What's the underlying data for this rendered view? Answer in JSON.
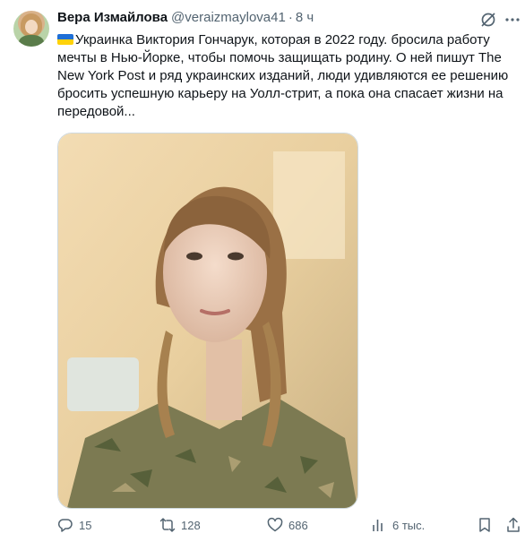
{
  "author": {
    "display_name": "Вера Измайлова",
    "handle": "@veraizmaylova41",
    "separator": "·",
    "time": "8 ч"
  },
  "tweet": {
    "flag_icon": "ukraine-flag-icon",
    "text": "Украинка Виктория Гончарук, которая в 2022 году. бросила работу мечты в Нью-Йорке, чтобы помочь защищать родину. О ней пишут The New York Post и ряд украинских изданий, люди удивляются ее решению бросить успешную карьеру на Уолл-стрит, а пока она спасает жизни на передовой..."
  },
  "actions": {
    "replies": "15",
    "reposts": "128",
    "likes": "686",
    "views": "6 тыс."
  },
  "colors": {
    "text": "#0f1419",
    "secondary": "#536471",
    "border": "#cfd9de"
  }
}
